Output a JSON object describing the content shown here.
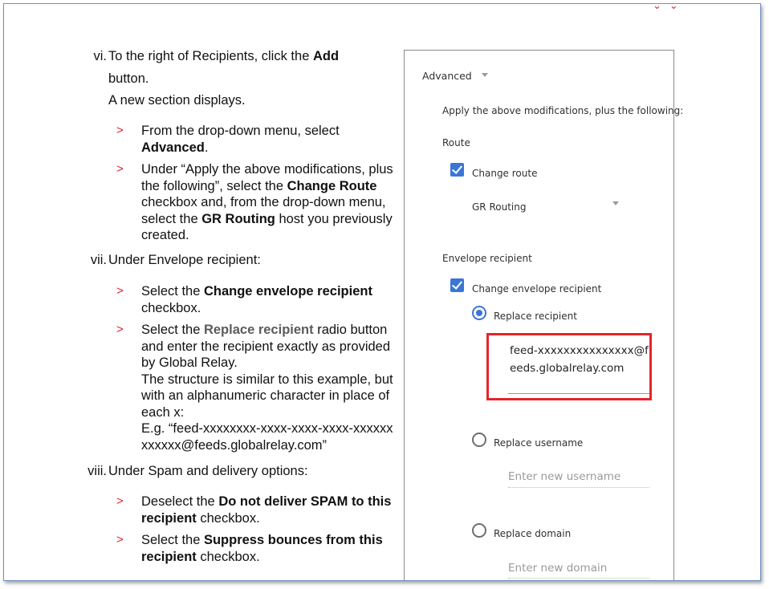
{
  "instructions": {
    "step_vi": {
      "number": "vi.",
      "line1_prefix": "To the right of Recipients, click the ",
      "line1_bold": "Add",
      "line2": "button.",
      "line3": "A new section displays.",
      "sub1": {
        "pre": "From the drop-down menu, select ",
        "bold": "Advanced",
        "post": "."
      },
      "sub2": {
        "pre": "Under “Apply the above modifications, plus the following”, select the ",
        "bold1": "Change Route",
        "mid": " checkbox and, from the drop-down menu, select the ",
        "bold2": "GR Routing",
        "post": " host you previously created."
      }
    },
    "step_vii": {
      "number": "vii.",
      "text": "Under Envelope recipient:",
      "sub1": {
        "pre": "Select the ",
        "bold": "Change envelope recipient",
        "post": " checkbox."
      },
      "sub2": {
        "pre": "Select the ",
        "bold": "Replace recipient",
        "post": " radio button and enter the recipient exactly as provided by Global Relay.",
        "line2": "The structure is similar to this example, but with an alphanumeric character in place of each x:",
        "line3": "E.g. “feed-xxxxxxxx-xxxx-xxxx-xxxx-xxxxxxxxxxxx@feeds.globalrelay.com”"
      }
    },
    "step_viii": {
      "number": "viii.",
      "text": "Under Spam and delivery options:",
      "sub1": {
        "pre": "Deselect the ",
        "bold": "Do not deliver SPAM to this recipient",
        "post": " checkbox."
      },
      "sub2": {
        "pre": "Select the ",
        "bold": "Suppress bounces from this recipient",
        "post": " checkbox."
      }
    },
    "bullet_glyph": ">"
  },
  "panel": {
    "dropdown_value": "Advanced",
    "apply_text": "Apply the above modifications, plus the following:",
    "route_heading": "Route",
    "change_route_label": "Change route",
    "change_route_checked": true,
    "route_select_value": "GR Routing",
    "envelope_heading": "Envelope recipient",
    "change_envelope_label": "Change envelope recipient",
    "change_envelope_checked": true,
    "replace_recipient_label": "Replace recipient",
    "replace_recipient_value": "feed-xxxxxxxxxxxxxxx@feeds.globalrelay.com",
    "replace_username_label": "Replace username",
    "username_placeholder": "Enter new username",
    "replace_domain_label": "Replace domain",
    "domain_placeholder": "Enter new domain"
  },
  "colors": {
    "accent_red": "#d9252b",
    "highlight_box": "#e5242b",
    "checkbox_blue": "#3a76d6"
  }
}
